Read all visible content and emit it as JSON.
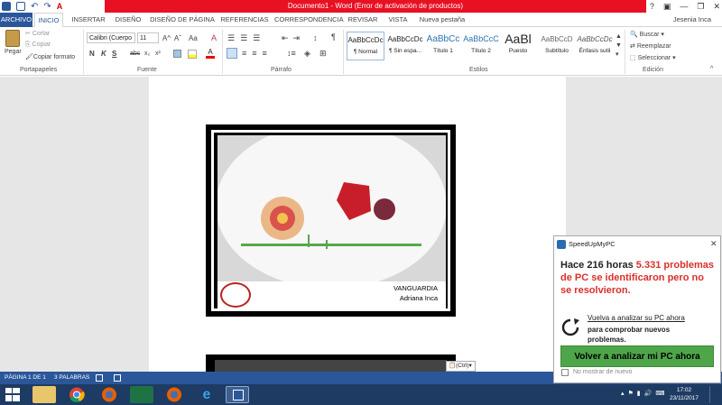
{
  "title_bar": {
    "title": "Documento1 - Word (Error de activación de productos)",
    "help": "?",
    "minimize": "—",
    "restore": "❐",
    "close": "✕"
  },
  "tabs": [
    "ARCHIVO",
    "INICIO",
    "INSERTAR",
    "DISEÑO",
    "DISEÑO DE PÁGINA",
    "REFERENCIAS",
    "CORRESPONDENCIA",
    "REVISAR",
    "VISTA",
    "Nueva pestaña"
  ],
  "user": "Jesenia Inca",
  "ribbon": {
    "clipboard": {
      "pegar": "Pegar",
      "cortar": "Cortar",
      "copiar": "Copiar",
      "copiar_formato": "Copiar formato",
      "label": "Portapapeles"
    },
    "font": {
      "name": "Calibri (Cuerpo",
      "size": "11",
      "label": "Fuente",
      "bold": "N",
      "italic": "K",
      "underline": "S",
      "strike": "abc",
      "sub": "x₂",
      "sup": "x²",
      "grow": "A^",
      "shrink": "Aˇ",
      "case": "Aa",
      "clear": "A"
    },
    "paragraph": {
      "label": "Párrafo",
      "pilcrow": "¶"
    },
    "styles": {
      "label": "Estilos",
      "items": [
        {
          "sample": "AaBbCcDc",
          "name": "¶ Normal"
        },
        {
          "sample": "AaBbCcDc",
          "name": "¶ Sin espa..."
        },
        {
          "sample": "AaBbCc",
          "name": "Título 1"
        },
        {
          "sample": "AaBbCcC",
          "name": "Título 2"
        },
        {
          "sample": "AaBl",
          "name": "Puesto"
        },
        {
          "sample": "AaBbCcD",
          "name": "Subtítulo"
        },
        {
          "sample": "AaBbCcDc",
          "name": "Énfasis sutil"
        }
      ]
    },
    "editing": {
      "label": "Edición",
      "buscar": "Buscar",
      "reemplazar": "Reemplazar",
      "seleccionar": "Seleccionar"
    }
  },
  "document": {
    "caption_line1": "VANGUARDIA",
    "caption_line2": "Adriana Inca",
    "paste_ctrl": "(Ctrl)"
  },
  "statusbar": {
    "page": "PÁGINA 1 DE 1",
    "words": "3 PALABRAS"
  },
  "popup": {
    "app": "SpeedUpMyPC",
    "close": "✕",
    "msg_part1": "Hace 216 horas ",
    "msg_red1": "5.331 problemas de PC se identificaron pero no se resolvieron.",
    "rescan_link": "Vuelva a analizar su PC ahora",
    "rescan_rest": "para comprobar nuevos problemas.",
    "button": "Volver a analizar mi PC ahora",
    "dont_show": "No mostrar de nuevo"
  },
  "taskbar": {
    "time": "17:02",
    "date": "23/11/2017"
  },
  "colors": {
    "word_blue": "#2b579a",
    "error_red": "#e81123",
    "popup_green": "#4fa64a",
    "popup_red": "#d9302b"
  }
}
